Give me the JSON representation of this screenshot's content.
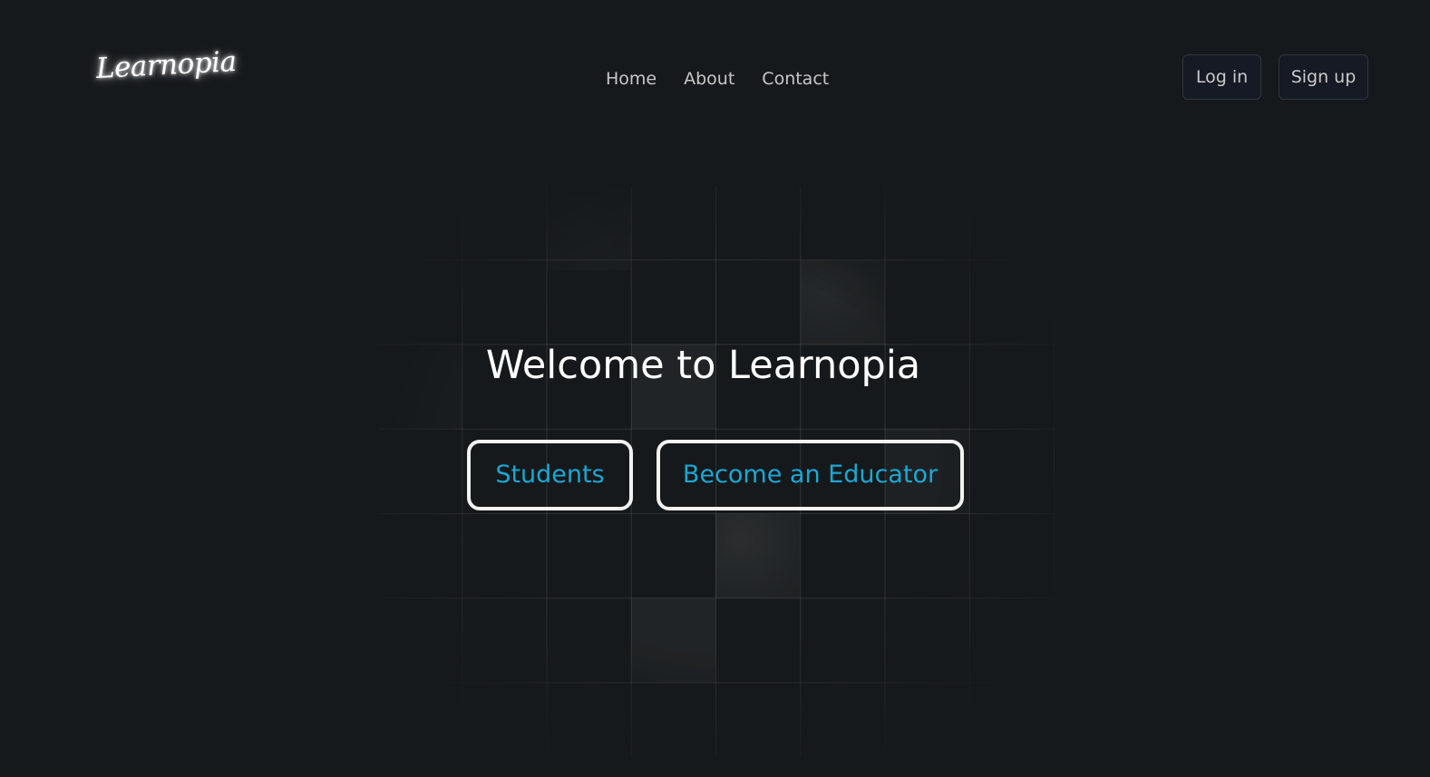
{
  "header": {
    "logo_text": "Learnopia",
    "nav": [
      {
        "label": "Home"
      },
      {
        "label": "About"
      },
      {
        "label": "Contact"
      }
    ],
    "login_label": "Log in",
    "signup_label": "Sign up"
  },
  "hero": {
    "title": "Welcome to Learnopia",
    "students_label": "Students",
    "educator_label": "Become an Educator"
  },
  "colors": {
    "background": "#16191b",
    "accent": "#1ba7d4",
    "button_border": "#f2f2f2",
    "auth_button_bg": "#161a24"
  }
}
